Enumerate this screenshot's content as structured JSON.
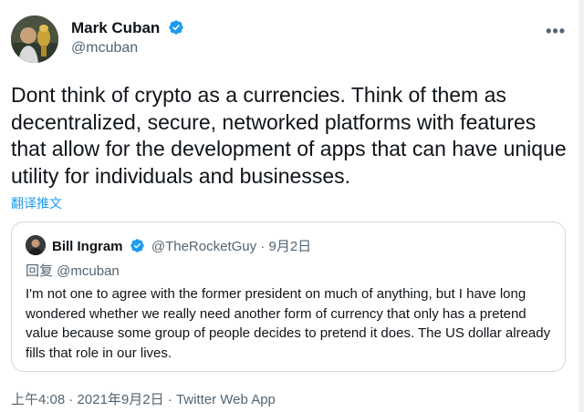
{
  "author": {
    "name": "Mark Cuban",
    "handle": "@mcuban",
    "verified_icon": "verified-badge-icon"
  },
  "more_label": "•••",
  "tweet": {
    "text": "Dont think of crypto as a currencies. Think of them as decentralized, secure, networked platforms with features that allow for the development of apps that can have unique utility for individuals and businesses.",
    "translate_label": "翻译推文"
  },
  "quote": {
    "name": "Bill Ingram",
    "handle": "@TheRocketGuy",
    "separator": " · ",
    "date": "9月2日",
    "reply_to": "回复 @mcuban",
    "text": "I'm not one to agree with the former president on much of anything, but I have long wondered whether we really need another form of currency that only has a pretend value because some group of people decides to pretend it does. The US dollar already fills that role in our lives."
  },
  "footer": {
    "time": "上午4:08",
    "separator": " · ",
    "date": "2021年9月2日",
    "source": "Twitter Web App"
  },
  "colors": {
    "accent": "#1d9bf0",
    "text": "#0f1419",
    "secondary": "#536471",
    "border": "#cfd9de"
  }
}
